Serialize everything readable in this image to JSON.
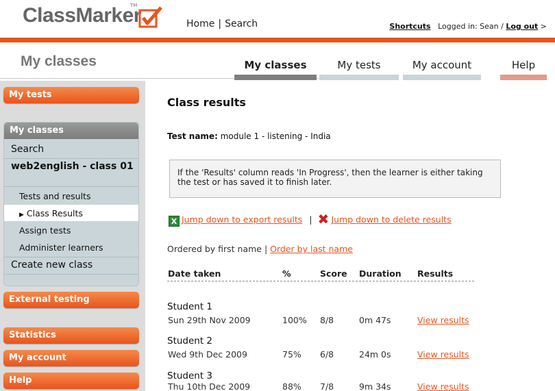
{
  "header": {
    "logo": "ClassMarker",
    "logo_tm": "TM",
    "nav_home": "Home",
    "nav_sep": "|",
    "nav_search": "Search",
    "shortcuts": "Shortcuts",
    "logged_in": "Logged in: Sean /",
    "logout": "Log out",
    "arrow": ">"
  },
  "colors": {
    "accent": "#e8541e",
    "tab_active": "#7f7f7f",
    "tab_inactive": "#c9d5d8",
    "tab_help": "#e49a88"
  },
  "page_title": "My classes",
  "tabs": [
    {
      "label": "My classes"
    },
    {
      "label": "My tests"
    },
    {
      "label": "My account"
    },
    {
      "label": "Help"
    }
  ],
  "sidebar": {
    "my_tests": "My tests",
    "my_classes": "My classes",
    "search": "Search",
    "class_name": "web2english - class 01",
    "tests_and_results": "Tests and results",
    "class_results": "Class Results",
    "assign_tests": "Assign tests",
    "administer_learners": "Administer learners",
    "create_new_class": "Create new class",
    "external_testing": "External testing",
    "statistics": "Statistics",
    "my_account": "My account",
    "help": "Help"
  },
  "main": {
    "title": "Class results",
    "test_name_label": "Test name:",
    "test_name_value": "module 1 - listening - India",
    "info": "If the 'Results' column reads 'In Progress', then the learner is either taking the test or has saved it to finish later.",
    "export_link": "Jump down to export results",
    "links_sep": "|",
    "delete_link": "Jump down to delete results",
    "ordered_by": "Ordered by first name |",
    "order_link": "Order by last name",
    "columns": [
      "Date taken",
      "%",
      "Score",
      "Duration",
      "Results"
    ],
    "rows": [
      {
        "name": "Student 1",
        "date": "Sun 29th Nov 2009",
        "percent": "100%",
        "score": "8/8",
        "duration": "0m 47s",
        "results": "View results"
      },
      {
        "name": "Student 2",
        "date": "Wed 9th Dec 2009",
        "percent": "75%",
        "score": "6/8",
        "duration": "24m 0s",
        "results": "View results"
      },
      {
        "name": "Student 3",
        "date": "Thu 10th Dec 2009",
        "percent": "88%",
        "score": "7/8",
        "duration": "9m 34s",
        "results": "View results"
      }
    ]
  }
}
